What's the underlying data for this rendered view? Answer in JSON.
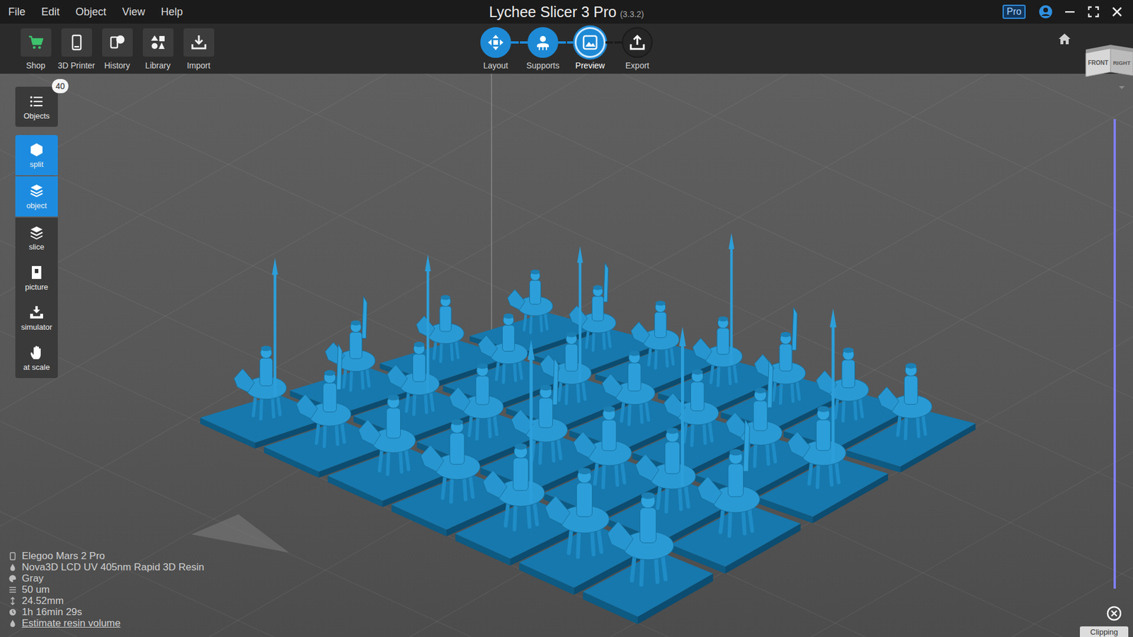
{
  "window": {
    "title": "Lychee Slicer 3 Pro",
    "version": "(3.3.2)"
  },
  "menu": [
    "File",
    "Edit",
    "Object",
    "View",
    "Help"
  ],
  "account": {
    "badge": "Pro"
  },
  "toolbar": [
    {
      "label": "Shop"
    },
    {
      "label": "3D Printer"
    },
    {
      "label": "History"
    },
    {
      "label": "Library"
    },
    {
      "label": "Import"
    }
  ],
  "steps": [
    {
      "label": "Layout",
      "done": true,
      "selected": false
    },
    {
      "label": "Supports",
      "done": true,
      "selected": false
    },
    {
      "label": "Preview",
      "done": true,
      "selected": true
    },
    {
      "label": "Export",
      "done": false,
      "selected": false
    }
  ],
  "side_tools": [
    {
      "label": "Objects",
      "badge": "40",
      "selected": false
    },
    {
      "label": "split",
      "selected": true
    },
    {
      "label": "object",
      "selected": true
    },
    {
      "label": "slice",
      "selected": false
    },
    {
      "label": "picture",
      "selected": false
    },
    {
      "label": "simulator",
      "selected": false
    },
    {
      "label": "at scale",
      "selected": false
    }
  ],
  "view_cube": {
    "front": "FRONT",
    "right": "RIGHT"
  },
  "info": [
    {
      "kind": "printer",
      "text": "Elegoo Mars 2 Pro"
    },
    {
      "kind": "resin",
      "text": "Nova3D LCD UV 405nm Rapid 3D Resin"
    },
    {
      "kind": "color",
      "text": "Gray"
    },
    {
      "kind": "layer",
      "text": "50 um"
    },
    {
      "kind": "height",
      "text": "24.52mm"
    },
    {
      "kind": "time",
      "text": "1h 16min 29s"
    },
    {
      "kind": "link",
      "text": "Estimate resin volume"
    }
  ],
  "clip_slider": {
    "level": 1
  },
  "clipping": {
    "label": "Clipping"
  }
}
